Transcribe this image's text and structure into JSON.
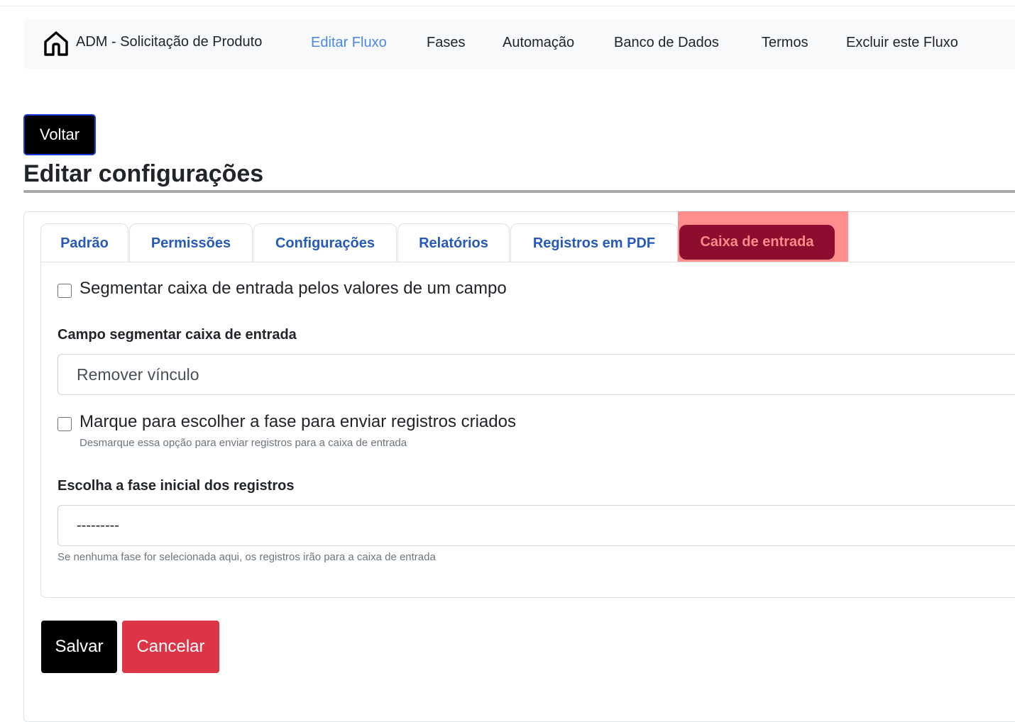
{
  "navbar": {
    "brand_icon": "home-icon",
    "brand": "ADM - Solicitação de Produto",
    "links": [
      "Editar Fluxo",
      "Fases",
      "Automação",
      "Banco de Dados",
      "Termos",
      "Excluir este Fluxo"
    ],
    "active_link": "Editar Fluxo",
    "active_color": "#4c86e6"
  },
  "back_button": "Voltar",
  "page_title": "Editar configurações",
  "tabs": [
    "Padrão",
    "Permissões",
    "Configurações",
    "Relatórios",
    "Registros em PDF",
    "Caixa de entrada"
  ],
  "active_tab": "Caixa de entrada",
  "active_tab_color": "#8c0d2e",
  "form": {
    "segment_checkbox": {
      "label": "Segmentar caixa de entrada pelos valores de um campo",
      "checked": false
    },
    "segment_field": {
      "label": "Campo segmentar caixa de entrada",
      "value": "Remover vínculo"
    },
    "phase_checkbox": {
      "label": "Marque para escolher a fase para enviar registros criados",
      "help": "Desmarque essa opção para enviar registros para a caixa de entrada",
      "checked": false
    },
    "initial_phase": {
      "label": "Escolha a fase inicial dos registros",
      "value": "---------",
      "help": "Se nenhuma fase for selecionada aqui, os registros irão para a caixa de entrada"
    }
  },
  "actions": {
    "save": "Salvar",
    "cancel": "Cancelar",
    "cancel_color": "#dc3545"
  }
}
